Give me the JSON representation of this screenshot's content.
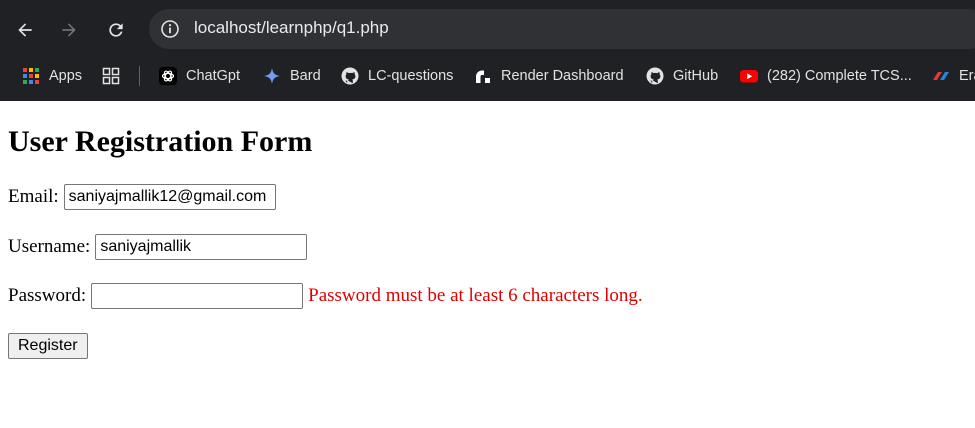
{
  "browser": {
    "url": "localhost/learnphp/q1.php",
    "bookmarks": [
      {
        "label": "Apps",
        "icon": "apps-grid-icon"
      },
      {
        "label": "",
        "icon": "tab-groups-icon"
      },
      {
        "label": "ChatGpt",
        "icon": "chatgpt-icon"
      },
      {
        "label": "Bard",
        "icon": "bard-sparkle-icon"
      },
      {
        "label": "LC-questions",
        "icon": "github-icon"
      },
      {
        "label": "Render Dashboard",
        "icon": "render-icon"
      },
      {
        "label": "GitHub",
        "icon": "github-icon"
      },
      {
        "label": "(282) Complete TCS...",
        "icon": "youtube-icon"
      },
      {
        "label": "Era",
        "icon": "era-icon"
      }
    ],
    "colors": {
      "frame": "#202124",
      "omnibox": "#303134",
      "text": "#e8eaed",
      "youtube": "#ff0000"
    }
  },
  "form": {
    "title": "User Registration Form",
    "email_label": "Email:",
    "email_value": "saniyajmallik12@gmail.com",
    "username_label": "Username:",
    "username_value": "saniyajmallik",
    "password_label": "Password:",
    "password_value": "",
    "password_error": "Password must be at least 6 characters long.",
    "register_label": "Register",
    "error_color": "#e00000"
  }
}
